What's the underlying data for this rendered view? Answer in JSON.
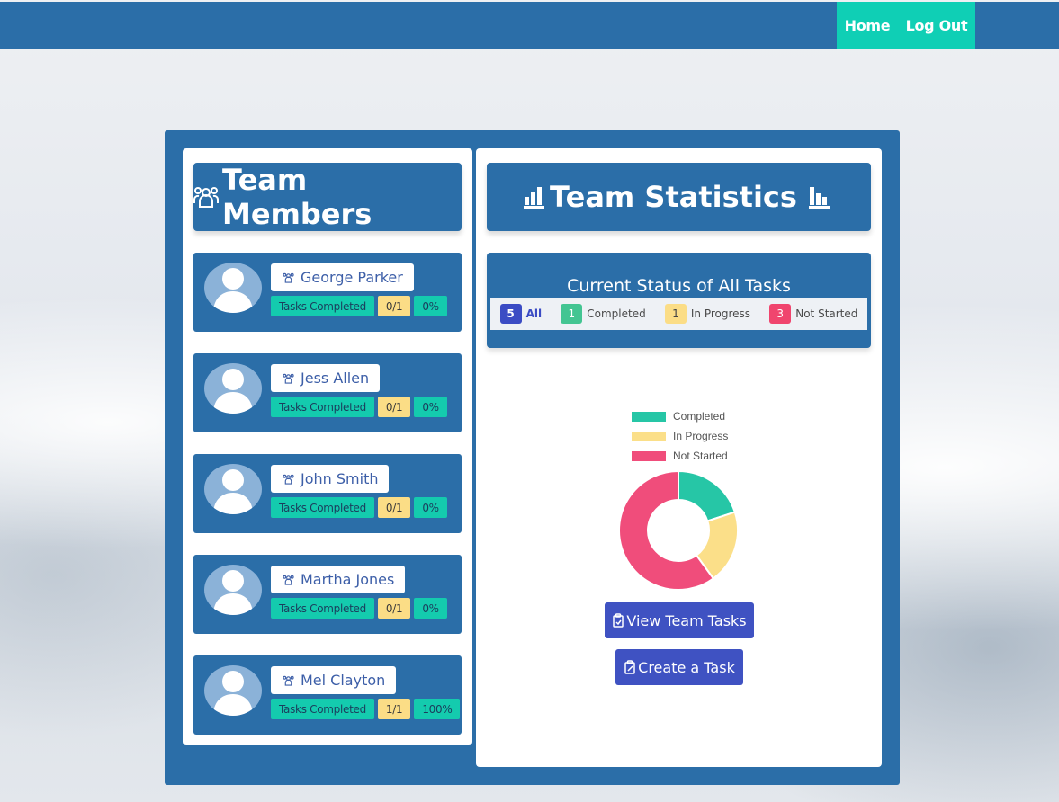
{
  "nav": {
    "home_label": "Home",
    "logout_label": "Log Out"
  },
  "members_panel": {
    "title": "Team Members",
    "badge_label": "Tasks Completed",
    "members": [
      {
        "name": "George Parker",
        "tasks": "0/1",
        "percent": "0%"
      },
      {
        "name": "Jess Allen",
        "tasks": "0/1",
        "percent": "0%"
      },
      {
        "name": "John Smith",
        "tasks": "0/1",
        "percent": "0%"
      },
      {
        "name": "Martha Jones",
        "tasks": "0/1",
        "percent": "0%"
      },
      {
        "name": "Mel Clayton",
        "tasks": "1/1",
        "percent": "100%"
      }
    ]
  },
  "stats_panel": {
    "title": "Team Statistics",
    "status_title": "Current Status of All Tasks",
    "status": [
      {
        "count": "5",
        "label": "All"
      },
      {
        "count": "1",
        "label": "Completed"
      },
      {
        "count": "1",
        "label": "In Progress"
      },
      {
        "count": "3",
        "label": "Not Started"
      }
    ],
    "view_button": "View Team Tasks",
    "create_button": "Create a Task"
  },
  "colors": {
    "brand": "#2b6ea8",
    "accent": "#0fcfb5",
    "button": "#3f52c2",
    "completed": "#26c6a6",
    "in_progress": "#fbdf89",
    "not_started": "#f04d7b"
  },
  "chart_data": {
    "type": "pie",
    "donut": true,
    "categories": [
      "Completed",
      "In Progress",
      "Not Started"
    ],
    "values": [
      1,
      1,
      3
    ],
    "colors": [
      "#26c6a6",
      "#fbdf89",
      "#f04d7b"
    ],
    "legend_position": "top"
  }
}
